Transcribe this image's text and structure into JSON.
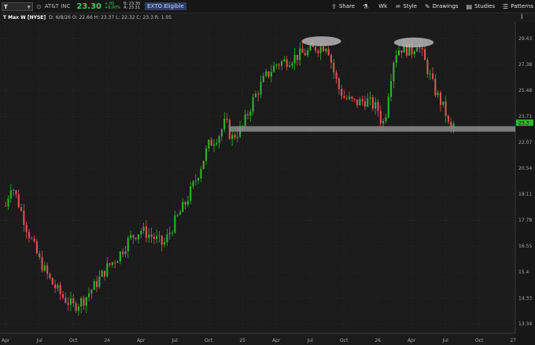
{
  "toolbar": {
    "symbol": "T",
    "company": "AT&T INC",
    "price": "23.30",
    "change_top": "+.00",
    "change_bottom": "+0.00%",
    "bid": "B: 23.30",
    "ask": "A: 23.31",
    "badge": "EXTO Eligible",
    "share_label": "Share",
    "timeframe_label": "Wk",
    "style_label": "Style",
    "drawings_label": "Drawings",
    "studies_label": "Studies",
    "patterns_label": "Patterns"
  },
  "infobar": {
    "title": "T Max W [NYSE]",
    "ohlc": "D: 6/8/26  O: 22.66  H: 23.37  L: 22.32  C: 23.3  R: 1.05"
  },
  "chart_data": {
    "type": "candlestick",
    "period": "weekly",
    "y_ticks": [
      29.43,
      27.38,
      25.48,
      23.71,
      22.07,
      20.54,
      19.11,
      17.78,
      16.55,
      15.4,
      14.33,
      13.34
    ],
    "x_ticks": [
      "Apr",
      "Jul",
      "Oct",
      "24",
      "Apr",
      "Jul",
      "Oct",
      "25",
      "Apr",
      "Jul",
      "Oct",
      "26",
      "Apr",
      "Jul",
      "Oct",
      "27"
    ],
    "last_price_label": "23.3",
    "ylim": [
      13.0,
      30.8
    ],
    "support_level": 22.9,
    "highlight_ellipses": [
      {
        "at_month": 28.0,
        "at_price": 29.2,
        "width_months": 3.5,
        "height_price": 0.8
      },
      {
        "at_month": 36.2,
        "at_price": 29.1,
        "width_months": 3.5,
        "height_price": 0.8
      }
    ],
    "path_keypoints": [
      [
        0,
        18.5
      ],
      [
        0.5,
        19.7
      ],
      [
        2,
        17.2
      ],
      [
        3,
        15.9
      ],
      [
        4,
        15.0
      ],
      [
        5,
        14.4
      ],
      [
        6,
        14.0
      ],
      [
        7,
        14.3
      ],
      [
        8,
        14.9
      ],
      [
        9,
        15.6
      ],
      [
        10,
        16.1
      ],
      [
        11,
        16.9
      ],
      [
        12,
        17.3
      ],
      [
        13,
        17.0
      ],
      [
        14,
        16.6
      ],
      [
        15,
        17.7
      ],
      [
        16,
        18.7
      ],
      [
        17,
        20.1
      ],
      [
        18,
        21.9
      ],
      [
        19,
        22.6
      ],
      [
        19.5,
        23.4
      ],
      [
        20,
        22.3
      ],
      [
        21,
        23.0
      ],
      [
        22,
        24.9
      ],
      [
        23,
        26.4
      ],
      [
        24,
        27.4
      ],
      [
        25,
        27.7
      ],
      [
        26,
        28.1
      ],
      [
        27,
        28.4
      ],
      [
        27.5,
        28.7
      ],
      [
        28,
        28.7
      ],
      [
        28.5,
        29.0
      ],
      [
        29,
        27.1
      ],
      [
        29.5,
        25.7
      ],
      [
        30,
        25.0
      ],
      [
        31,
        24.6
      ],
      [
        32,
        24.8
      ],
      [
        33,
        24.2
      ],
      [
        33.3,
        23.4
      ],
      [
        33.6,
        23.3
      ],
      [
        34,
        25.7
      ],
      [
        34.5,
        28.2
      ],
      [
        35,
        28.7
      ],
      [
        36,
        28.4
      ],
      [
        36.5,
        29.1
      ],
      [
        37,
        28.0
      ],
      [
        37.5,
        26.8
      ],
      [
        38,
        25.6
      ],
      [
        38.5,
        24.8
      ],
      [
        39,
        24.0
      ],
      [
        39.4,
        22.7
      ],
      [
        39.7,
        23.2
      ]
    ]
  }
}
